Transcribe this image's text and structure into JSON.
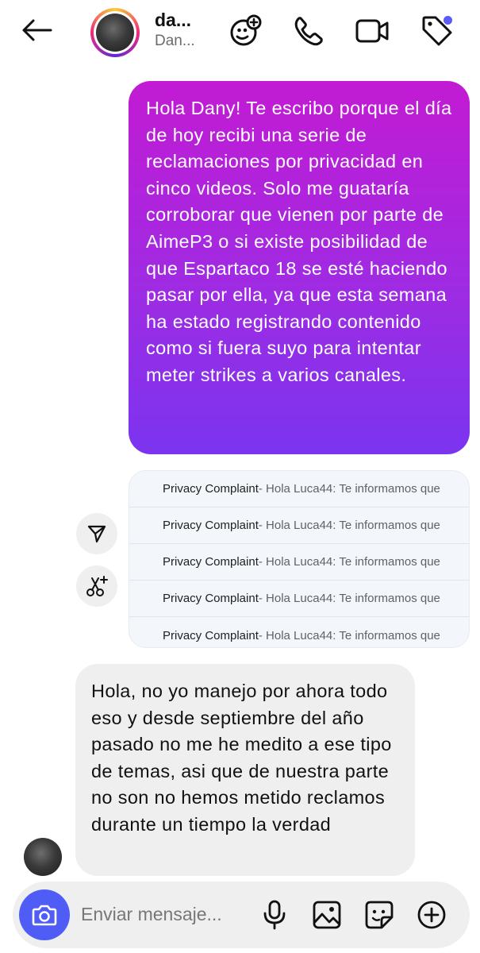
{
  "header": {
    "name": "da...",
    "subtitle": "Dan...",
    "icons": [
      "back-arrow-icon",
      "add-people-icon",
      "phone-icon",
      "video-icon",
      "tag-icon"
    ],
    "accent": "#5b5cf6"
  },
  "messages": {
    "outgoing": "Hola Dany! Te escribo porque el día de hoy recibi una serie de reclamaciones por privacidad en cinco videos. Solo me guataría corroborar que vienen por parte de AimeP3 o si existe posibilidad de que Espartaco 18 se esté haciendo pasar por ella, ya que esta semana ha estado registrando contenido como si fuera suyo para intentar meter strikes a varios canales.",
    "attachment_rows": [
      {
        "subject": "Privacy Complaint",
        "snippet": " - Hola Luca44: Te informamos que"
      },
      {
        "subject": "Privacy Complaint",
        "snippet": " - Hola Luca44: Te informamos que"
      },
      {
        "subject": "Privacy Complaint",
        "snippet": " - Hola Luca44: Te informamos que"
      },
      {
        "subject": "Privacy Complaint",
        "snippet": " - Hola Luca44: Te informamos que"
      },
      {
        "subject": "Privacy Complaint",
        "snippet": " - Hola Luca44: Te informamos que"
      }
    ],
    "incoming": "Hola, no yo manejo por ahora todo eso y desde septiembre del año pasado no me he medito a ese tipo de temas, asi que de nuestra parte no son no hemos metido reclamos durante un tiempo la verdad"
  },
  "composer": {
    "placeholder": "Enviar mensaje...",
    "accent": "#4f5cf5"
  }
}
